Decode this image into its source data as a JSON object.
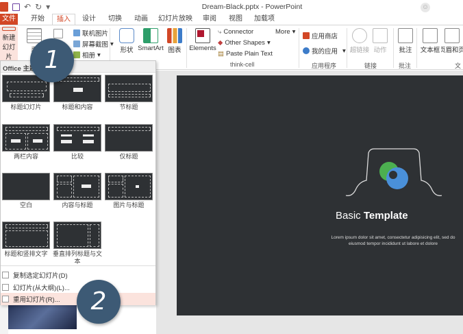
{
  "window": {
    "title": "Dream-Black.pptx - PowerPoint"
  },
  "tabs": [
    {
      "label": "文件"
    },
    {
      "label": "开始"
    },
    {
      "label": "插入"
    },
    {
      "label": "设计"
    },
    {
      "label": "切换"
    },
    {
      "label": "动画"
    },
    {
      "label": "幻灯片放映"
    },
    {
      "label": "审阅"
    },
    {
      "label": "视图"
    },
    {
      "label": "加载项"
    }
  ],
  "ribbon": {
    "new_slide": "新建\n幻灯片",
    "new_slide_line1": "新建",
    "new_slide_line2": "幻灯片",
    "table_label": "表",
    "online_pictures": "联机图片",
    "screenshot": "屏幕截图",
    "album": "相册",
    "shapes": "形状",
    "smartart": "SmartArt",
    "chart": "图表",
    "elements": "Elements",
    "connector": "Connector",
    "other_shapes": "Other Shapes",
    "paste_plain": "Paste Plain Text",
    "more": "More",
    "thinkcell_group": "think-cell",
    "app_store": "应用商店",
    "my_apps": "我的应用",
    "apps_group": "应用程序",
    "hyperlink": "超链接",
    "action": "动作",
    "links_group": "链接",
    "comment": "批注",
    "comments_group": "批注",
    "textbox": "文本框",
    "header_footer": "页眉和页",
    "text_group": "文"
  },
  "dropdown": {
    "header": "Office 主题",
    "layouts": [
      {
        "label": "标题幻灯片"
      },
      {
        "label": "标题和内容"
      },
      {
        "label": "节标题"
      },
      {
        "label": "两栏内容"
      },
      {
        "label": "比较"
      },
      {
        "label": "仅标题"
      },
      {
        "label": "空白"
      },
      {
        "label": "内容与标题"
      },
      {
        "label": "图片与标题"
      },
      {
        "label": "标题和竖排文字"
      },
      {
        "label": "垂直排列标题与文本"
      }
    ],
    "commands": [
      {
        "label": "复制选定幻灯片(D)"
      },
      {
        "label": "幻灯片(从大纲)(L)..."
      },
      {
        "label": "重用幻灯片(R)..."
      }
    ]
  },
  "slide": {
    "title_light": "Basic ",
    "title_bold": "Template",
    "body_line1": "Lorem ipsum dolor sit amet, consectetur adipisicing elit, sed do",
    "body_line2": "eiusmod tempor incididunt ut labore et dolore"
  },
  "steps": [
    {
      "label": "1"
    },
    {
      "label": "2"
    }
  ],
  "colors": {
    "accent": "#d24726",
    "step_circle": "#3d5a75",
    "slide_bg": "#2e3134"
  }
}
